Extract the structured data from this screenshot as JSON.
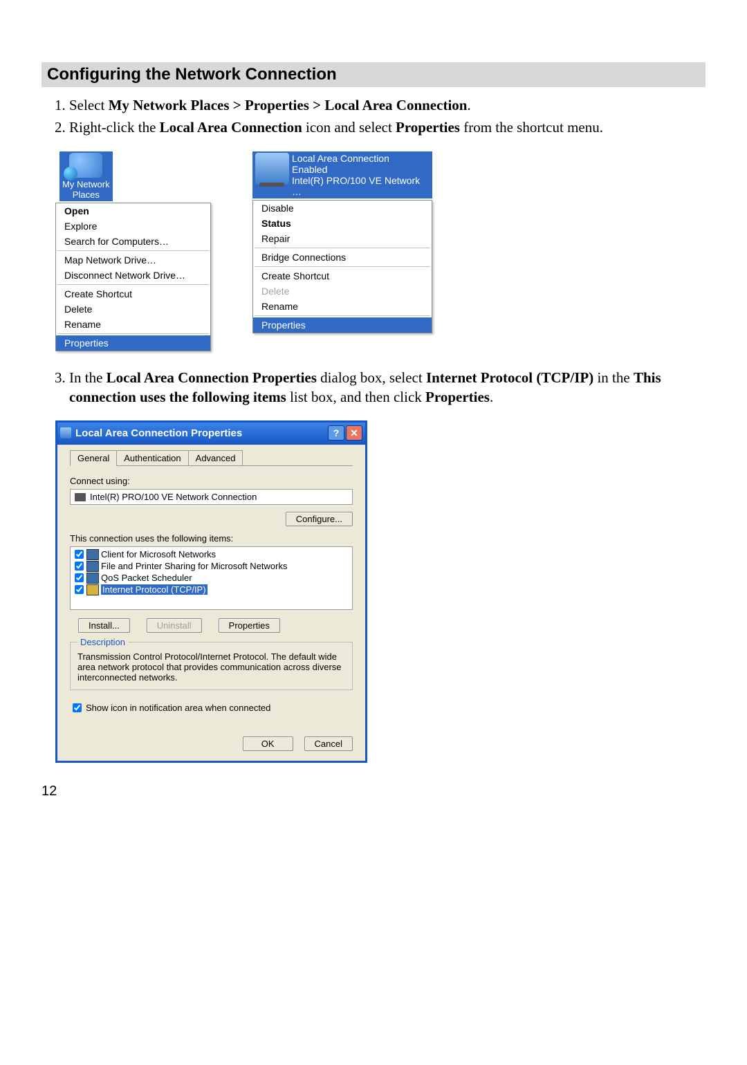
{
  "section_title": "Configuring the Network Connection",
  "steps": {
    "s1_pre": "Select ",
    "s1_bold": "My Network Places > Properties > Local Area Connection",
    "s1_post": ".",
    "s2_a": "Right-click the ",
    "s2_b": "Local Area Connection",
    "s2_c": " icon and select ",
    "s2_d": "Properties",
    "s2_e": " from the shortcut menu.",
    "s3_a": "In the ",
    "s3_b": "Local Area Connection Properties",
    "s3_c": " dialog box, select ",
    "s3_d": "Internet Protocol (TCP/IP)",
    "s3_e": " in the ",
    "s3_f": "This connection uses the following items",
    "s3_g": " list box, and then click ",
    "s3_h": "Properties",
    "s3_i": "."
  },
  "np_icon_label": "My Network\nPlaces",
  "np_menu": {
    "open": "Open",
    "explore": "Explore",
    "search": "Search for Computers…",
    "map": "Map Network Drive…",
    "disc": "Disconnect Network Drive…",
    "create": "Create Shortcut",
    "delete": "Delete",
    "rename": "Rename",
    "props": "Properties"
  },
  "lac_icon": {
    "l1": "Local Area Connection",
    "l2": "Enabled",
    "l3": "Intel(R) PRO/100 VE Network …"
  },
  "lac_menu": {
    "disable": "Disable",
    "status": "Status",
    "repair": "Repair",
    "bridge": "Bridge Connections",
    "create": "Create Shortcut",
    "delete": "Delete",
    "rename": "Rename",
    "props": "Properties"
  },
  "dialog": {
    "title": "Local Area Connection Properties",
    "tabs": {
      "general": "General",
      "auth": "Authentication",
      "adv": "Advanced"
    },
    "connect_using": "Connect using:",
    "adapter": "Intel(R) PRO/100 VE Network Connection",
    "configure": "Configure...",
    "uses_label": "This connection uses the following items:",
    "items": {
      "client": "Client for Microsoft Networks",
      "fps": "File and Printer Sharing for Microsoft Networks",
      "qos": "QoS Packet Scheduler",
      "tcpip": "Internet Protocol (TCP/IP)"
    },
    "install": "Install...",
    "uninstall": "Uninstall",
    "properties": "Properties",
    "desc_legend": "Description",
    "desc_text": "Transmission Control Protocol/Internet Protocol. The default wide area network protocol that provides communication across diverse interconnected networks.",
    "show_icon": "Show icon in notification area when connected",
    "ok": "OK",
    "cancel": "Cancel"
  },
  "page_number": "12"
}
